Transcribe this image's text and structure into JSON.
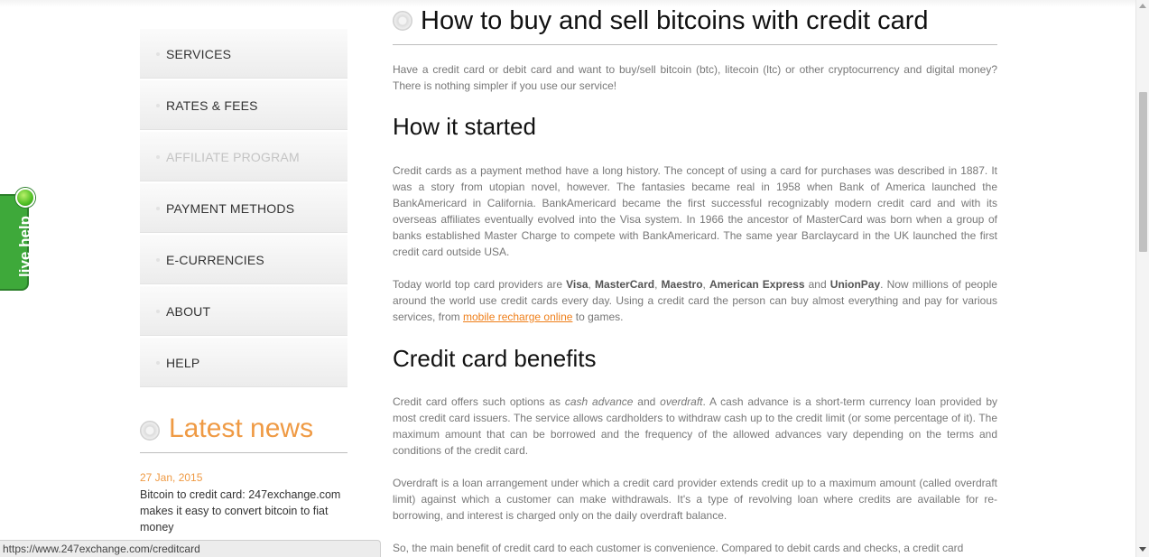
{
  "sidebar": {
    "menu": [
      {
        "label": "SERVICES"
      },
      {
        "label": "RATES & FEES"
      },
      {
        "label": "AFFILIATE PROGRAM"
      },
      {
        "label": "PAYMENT METHODS"
      },
      {
        "label": "E-CURRENCIES"
      },
      {
        "label": "ABOUT"
      },
      {
        "label": "HELP"
      }
    ],
    "news": {
      "title": "Latest news",
      "date": "27 Jan, 2015",
      "headline": "Bitcoin to credit card: 247exchange.com makes it easy to convert bitcoin to fiat money"
    }
  },
  "live_help": {
    "label": "live help"
  },
  "article": {
    "title": "How to buy and sell bitcoins with credit card",
    "intro": "Have a credit card or debit card and want to buy/sell bitcoin (btc), litecoin (ltc) or other cryptocurrency and digital money? There is nothing simpler if you use our service!",
    "h_started": "How it started",
    "started_p1": "Credit cards as a payment method have a long history. The concept of using a card for purchases was described in 1887. It was a story from utopian novel, however. The fantasies became real in 1958 when Bank of America launched the BankAmericard in California. BankAmericard became the first successful recognizably modern credit card and with its overseas affiliates eventually evolved into the Visa system. In 1966 the ancestor of MasterCard was born when a group of banks established Master Charge to compete with BankAmericard. The same year Barclaycard in the UK launched the first credit card outside USA.",
    "started_p2": {
      "t1": "Today world top card providers are ",
      "visa": "Visa",
      "c1": ", ",
      "mastercard": "MasterCard",
      "c2": ", ",
      "maestro": "Maestro",
      "c3": ", ",
      "amex": "American Express",
      "and": " and ",
      "unionpay": "UnionPay",
      "t2": ". Now millions of people around the world use credit cards every day. Using a credit card the person can buy almost everything and pay for various services, from ",
      "link": "mobile recharge online",
      "t3": " to games."
    },
    "h_benefits": "Credit card benefits",
    "benefits_p1": {
      "t1": "Credit card offers such options as ",
      "cash_advance": "cash advance",
      "and": " and ",
      "overdraft": "overdraft",
      "t2": ". A cash advance is a short-term currency loan provided by most credit card issuers. The service allows cardholders to withdraw cash up to the credit limit (or some percentage of it). The maximum amount that can be borrowed and the frequency of the allowed advances vary depending on the terms and conditions of the credit card."
    },
    "benefits_p2": "Overdraft is a loan arrangement under which a credit card provider extends credit up to a maximum amount (called overdraft limit) against which a customer can make withdrawals. It's a type of revolving loan where credits are available for re-borrowing, and interest is charged only on the daily overdraft balance.",
    "benefits_p3": "So, the main benefit of credit card to each customer is convenience. Compared to debit cards and checks, a credit card"
  },
  "status_bar": {
    "url": "https://www.247exchange.com/creditcard"
  }
}
